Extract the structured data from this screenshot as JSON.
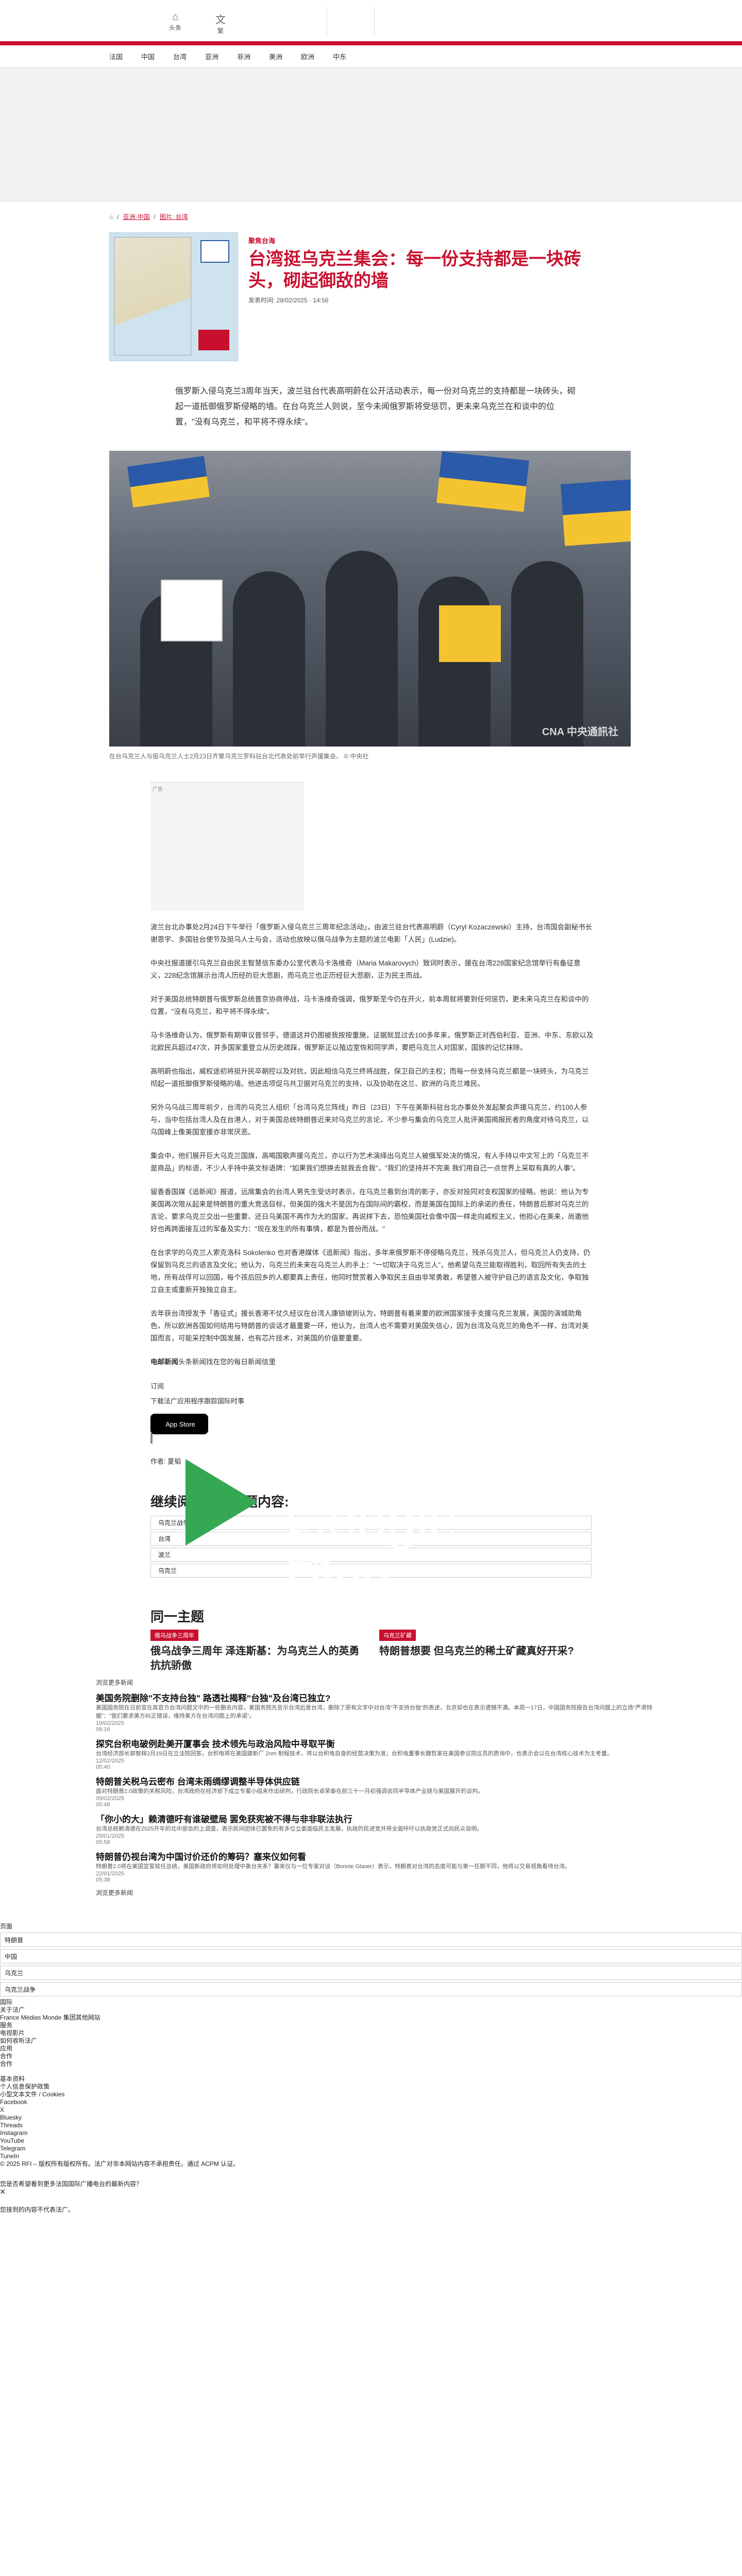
{
  "topbar": {
    "home_icon": "home-icon",
    "home_label": "头条",
    "lang_icon": "translate-icon",
    "lang_label": "繁"
  },
  "nav": [
    "法国",
    "中国",
    "台湾",
    "亚洲",
    "非洲",
    "美洲",
    "欧洲",
    "中东"
  ],
  "breadcrumb": {
    "home_icon": "home-icon",
    "item1": "亚洲·中国",
    "item2": "图片: 台湾"
  },
  "article": {
    "kicker": "聚焦台海",
    "title": "台湾挺乌克兰集会：每一份支持都是一块砖头，砌起御敌的墙",
    "meta": "发表时间: 28/02/2025 · 14:56",
    "lead": "俄罗斯入侵乌克兰3周年当天，波兰驻台代表高明蔚在公开活动表示，每一份对乌克兰的支持都是一块砖头，砌起一道抵御俄罗斯侵略的墙。在台乌克兰人则说，至今未闻俄罗斯将受惩罚，更未来乌克兰在和谈中的位置，\"没有乌克兰，和平将不得永续\"。",
    "caption": "在台乌克兰人与挺乌克兰人士2月23日齐聚乌克兰罗科驻台北代表处前举行声援集会。 © 中央社",
    "ad_label": "广告",
    "paragraphs": [
      "波兰台北办事处2月24日下午举行「俄罗斯入侵乌克兰三周年纪念活动」，由波兰驻台代表高明蔚（Cyryl Kozaczewski）主持，台湾国会副秘书长谢恩宇、多国驻台使节及挺乌人士与会，活动也放映以俄乌战争为主题的波兰电影「人民」(Ludzie)。",
      "中央社报道援引乌克兰自由民主智慧信东委办公室代表马卡洛维奇（Maria Makarovych）致词时表示，援在台湾228国家纪念馆举行有备征意义，228纪念馆展示台湾人历经的巨大悲剧，而乌克兰也正历经巨大悲剧，正为民主而战。",
      "对于美国总统特朗普与俄罗斯总统普京协商停战，马卡洛维奇强调，俄罗斯至今仍在开火，前本周就将要到任何惩罚，更未来乌克兰在和谈中的位置，\"没有乌克兰，和平将不得永续\"。",
      "马卡洛维奇认为，俄罗斯有期审议普邻乎，德道这并仍图被我按按重施，证据就显过去100多年来，俄罗斯正对西伯利亚、亚洲、中东、东欧以及北欧民兵超过47次，并多国家重登立从历史疏踩，俄罗斯正以殖边室恢和同学声，要把乌克兰人对国家，国族的记忆抹除。",
      "高明蔚也指出，威权途初将挺升民卒朝控以及对抗，因此相信乌克兰终将战胜，保卫自己的主权；而每一份支持乌克兰都是一块砖头，为乌克兰彻起一道抵御俄罗斯侵略的墙。他进击项促乌共卫据对乌克兰的支持，以及协助在这兰、欧洲的乌克兰难民。",
      "另外乌乌战三周年前夕，台湾的乌克兰人组织「台湾乌克兰阵线」昨日（23日）下午在美斯科驻台北办事处外发起聚会声援乌克兰，约100人参与，当中包括台湾人及在台港人，对于美国总统特朗普近来对乌克兰的言论，不少参与集会的乌克兰人批评美国揭报民者的角度对待乌克兰，以乌国峰上像美国室援亦非常厌恶。",
      "集会中，他们展开巨大乌克兰国旗，高喝国歌声援乌克兰，亦以行为艺术演绎出乌克兰人被俄军处决的情况，有人手持以中文写上的「乌克兰不是商品」的标语，不少人手持中英文标语牌：\"如果我们想换去就我去合我\"，\"我们的坚持并不完美 我们用自己一点世界上采取有真的人事\"。",
      "留香香国媒《追新闻》报道，远席集会的台湾人男先生受访时表示，在乌克兰看到台湾的影子，亦反对投同对支权国家的侵略。他说：他认为专美国再次限从起来是特朗普的重大竞选目标，但美国的强大不是因为在国际间的霸权，而是美国在国际上的承诺的责任，特朗普后那对乌克兰的言论，要求乌克兰交出一些重要、还日乌美国不再作为大的国家，再说样下去，恐怕美国社会像中国一样走向威权主义，他担心在美来，尚邀他好也再跨面接互过的军备及实力：\"现在发生的所有事情，都是为普份而战。\"",
      "在台求学的乌克兰人索克洛科 Sokolenko 也对香港媒体《追新闻》指出，多年来俄罗斯不停侵略乌克兰，残杀乌克兰人，但乌克兰人仍支持，仍保留到乌克兰的语言及文化；他认为，乌克兰的未来在乌克兰人的手上：\"一切取决于乌克兰人\"，他希望乌克兰能取得胜利，取回所有失去的土地，所有战俘可以回国，每个孩后回乡的人都要真上责任，他同时赞赏着入争取民主自由非常勇敢，希望普入被守护自己的语言及文化，争取独立自主或重新开独独立自主。",
      "去年获台湾授发予「香征式」援长香港不仗久经议在台湾人康锁坡则认为，特朗普有着来要的欧洲国家接手支援乌克兰发展，美国的演城助角色，所以欧洲各国如何结用与特朗普的谈话才最重要一环，他认为，台湾人也不需要对美国失信心，因为台湾及乌克兰的角色不一样，台湾对美国而言，可能采控制中国发展，也有芯片技术，对美国的价值要重要。"
    ],
    "rfi_strong": "电邮新闻",
    "rfi_rest": "头条新闻找在您的每日新闻信里",
    "subscribe": "订阅",
    "download_line": "下载法广应用程序跟踪国际时事",
    "appstore": "App Store",
    "gplay_small": "下载应用，请到",
    "gplay_big": "Google Play",
    "author": "作者:  夏韬"
  },
  "more": {
    "title": "继续阅读相同主题内容:",
    "tags": [
      "乌克兰战争",
      "台湾",
      "波兰",
      "乌克兰"
    ]
  },
  "same": {
    "title": "同一主题",
    "cards": [
      {
        "badge": "俄乌战争三周年",
        "title": "俄乌战争三周年 泽连斯基：为乌克兰人的英勇抗抗骄傲"
      },
      {
        "badge": "乌克兰矿藏",
        "title": "特朗普想要 但乌克兰的稀土矿藏真好开采?"
      }
    ]
  },
  "news": {
    "label": "浏览更多新闻",
    "items": [
      {
        "h": "美国务院删除\"不支持台独\" 路透社揭释\"台独\"及台湾已独立?",
        "d": "美国国务院在日前官在其官方台湾问题文中的一些删去内容，美国务院先告示台湾后是台湾，删除了原有文字中对台湾\"不支持台独\"的表述，北京却也在表示遗憾不满。本周一17日，中国国务院报告台湾问题上的立场\"严肃特据\"：\"我们要求美方纠正错误，维持美方在台湾问题上的承诺\"。",
        "t": "19/02/2025\n06:16"
      },
      {
        "h": "探究台积电破例赴美开厦事会 技术领先与政治风险中寻取平衡",
        "d": "台湾经济部长郭智辉2月19日在立法院回答，台积电将在美国建新厂 2nm 制程技术，将以台积电自身的经营决策为准；台积电董事长魏哲家在美国参议院议员的质询中，也表示会以在台湾核心技术为主考量。",
        "t": "12/02/2025\n05:40"
      },
      {
        "h": "特朗普关税乌云密布 台湾未雨绸缪调整半导体供应链",
        "d": "面对特朗普2.0政策的关税风险，台湾政府在经济部下成立专案小组来作出研判，行政院长卓荣泰在前三十一月初强调会同半导体产业链与美国展开的谈判。",
        "t": "09/02/2025\n05:48"
      },
      {
        "h": "「你小的大」赖清德吁有谁破壁局 罢免获宪被不得与非非联法执行",
        "d": "台湾总统赖清德在2025开年的北中部会的上调查，表示民间团体已罢免的有多位立委面临民主发展，执政的民进党并将全面呼吁以执政党正式向民众说明。",
        "t": "29/01/2025\n05:58"
      },
      {
        "h": "特朗普仍视台湾为中国讨价还价的筹码？塞来仪如何看",
        "d": "特朗普2.0将在美国宣誓就任总统，美国新政府将如何处理中美台关系？塞来仪与一位专家对谈（Bonnie Glaser）表示，特朗普对台湾的态度可能与第一任期不同，他将以交易视角看待台湾。",
        "t": "22/01/2025\n05:38"
      }
    ],
    "more_label": "浏览更多新闻"
  },
  "footer": {
    "heading": "页面",
    "boxes": [
      "特朗普",
      "中国",
      "乌克兰",
      "乌克兰战争"
    ],
    "lines": [
      "国际",
      "关于法广",
      "France Médias Monde 集团其他网站",
      "服务",
      "电视影片",
      "如何收听法广",
      "应用",
      "合作",
      "合作",
      "",
      "基本资料",
      "个人信息保护政策",
      "小型文本文件 / Cookies",
      "Facebook",
      "X",
      "Bluesky",
      "Threads",
      "Instagram",
      "YouTube",
      "Telegram",
      "TuneIn",
      "© 2025 RFI – 版权所有版权所有。法广对非本网站内容不承担责任。通过 ACPM 认证。"
    ],
    "close_glyph": "×",
    "notice": "您是否希望看到更多法国国际广播电台的最新内容？",
    "notice2": "您接到的内容不代表法广。"
  }
}
